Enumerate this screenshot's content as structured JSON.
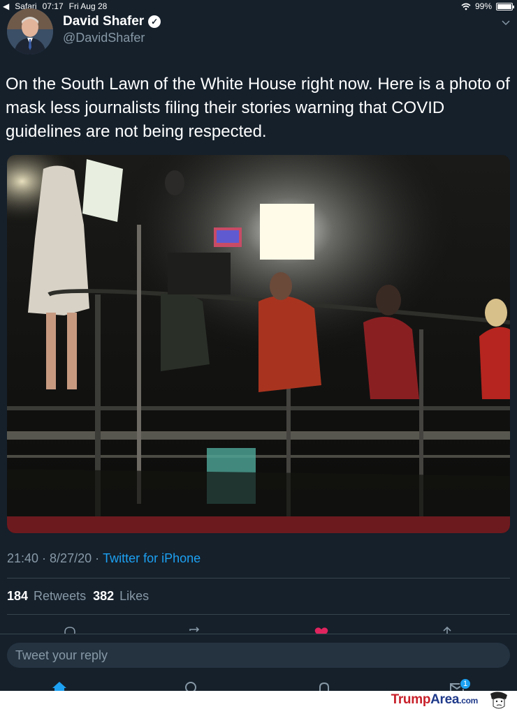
{
  "status_bar": {
    "app": "Safari",
    "time": "07:17",
    "date": "Fri Aug 28",
    "battery": "99%",
    "battery_level": 0.99,
    "back_icon": "back-triangle-icon",
    "wifi_icon": "wifi-icon"
  },
  "tweet": {
    "author_name": "David Shafer",
    "author_handle": "@DavidShafer",
    "verified_icon": "verified-check-icon",
    "text": "On the South Lawn of the White House right now. Here is a photo of mask less journalists filing their stories warning that COVID guidelines are not being respected.",
    "time": "21:40",
    "date": "8/27/20",
    "separator": "·",
    "source": "Twitter for iPhone",
    "retweets_count": "184",
    "retweets_label": "Retweets",
    "likes_count": "382",
    "likes_label": "Likes"
  },
  "actions": {
    "icons": [
      "reply-icon",
      "retweet-icon",
      "like-icon-filled",
      "share-icon"
    ],
    "like_color": "#e0245e"
  },
  "reply": {
    "placeholder": "Tweet your reply"
  },
  "tab_bar": {
    "icons": [
      "home-icon",
      "search-icon",
      "notifications-icon",
      "messages-icon"
    ],
    "messages_badge": "1"
  },
  "watermark": {
    "part1": "Trump",
    "part2": "Area",
    "part3": ".com"
  },
  "colors": {
    "background": "#15202b",
    "accent": "#1da1f2",
    "muted": "#8899a6",
    "divider": "#38444d"
  }
}
